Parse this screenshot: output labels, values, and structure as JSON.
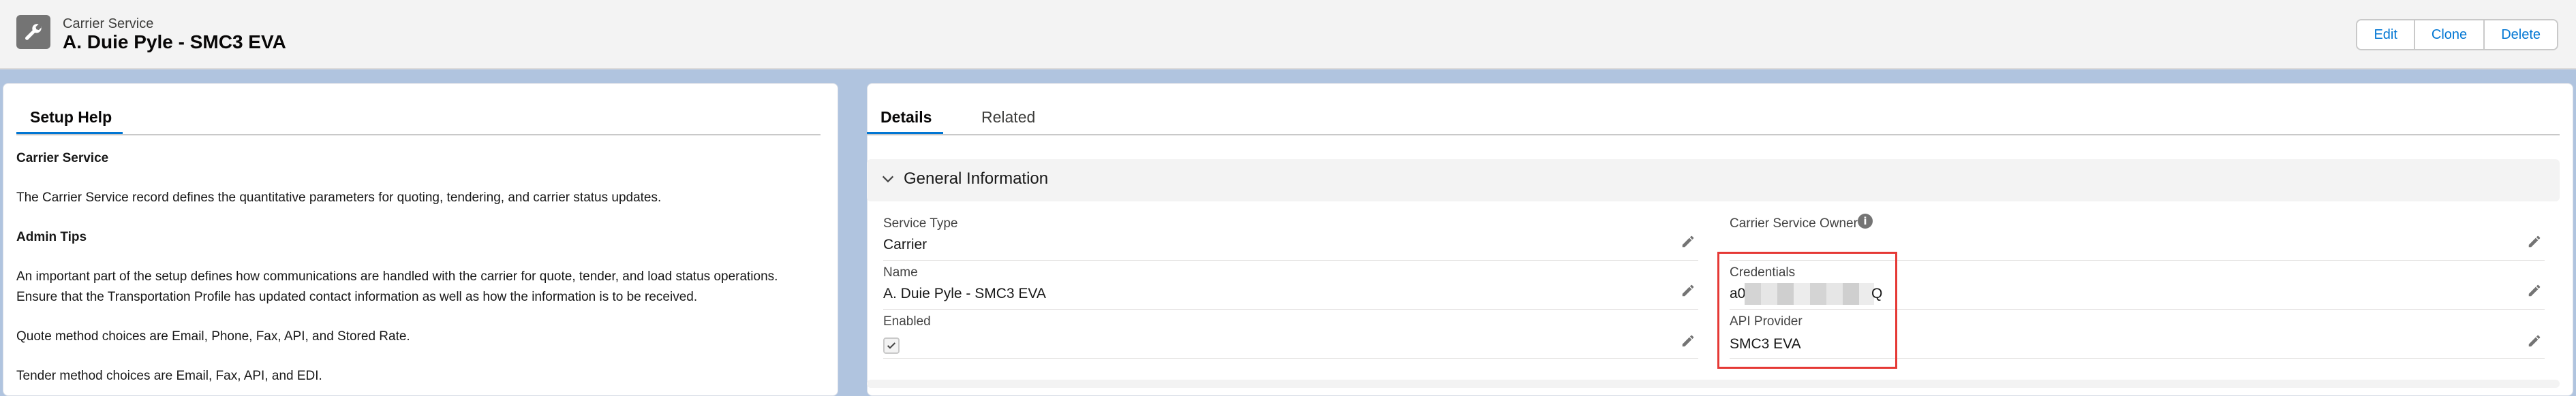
{
  "header": {
    "object_type": "Carrier Service",
    "record_title": "A. Duie Pyle - SMC3 EVA",
    "buttons": {
      "edit": "Edit",
      "clone": "Clone",
      "delete": "Delete"
    }
  },
  "left_panel": {
    "tab": "Setup Help",
    "heading": "Carrier Service",
    "description": "The Carrier Service record defines the quantitative parameters for quoting, tendering, and carrier status updates.",
    "admin_tips_heading": "Admin Tips",
    "admin_tips_line1": "An important part of the setup defines how communications are handled with the carrier for quote, tender, and load status operations.",
    "admin_tips_line2": "Ensure that the Transportation Profile has updated contact information as well as how the information is to be received.",
    "quote_methods": "Quote method choices are Email, Phone, Fax, API, and Stored Rate.",
    "tender_methods": "Tender method choices are Email, Fax, API, and EDI."
  },
  "right_panel": {
    "tabs": {
      "details": "Details",
      "related": "Related"
    },
    "section_title": "General Information",
    "fields": {
      "service_type": {
        "label": "Service Type",
        "value": "Carrier"
      },
      "name": {
        "label": "Name",
        "value": "A. Duie Pyle - SMC3 EVA"
      },
      "enabled": {
        "label": "Enabled",
        "checked": true
      },
      "owner": {
        "label": "Carrier Service Owner",
        "value": ""
      },
      "credentials": {
        "label": "Credentials",
        "value_prefix": "a0",
        "value_suffix": "Q"
      },
      "api_provider": {
        "label": "API Provider",
        "value": "SMC3 EVA"
      }
    }
  },
  "icons": {
    "header": "wrench-icon",
    "edit": "pencil-icon",
    "section": "chevron-down-icon",
    "info": "info-icon",
    "check": "check-icon"
  },
  "colors": {
    "brand_blue": "#0176d3",
    "highlight_red": "#e53935",
    "background": "#b0c4df"
  }
}
